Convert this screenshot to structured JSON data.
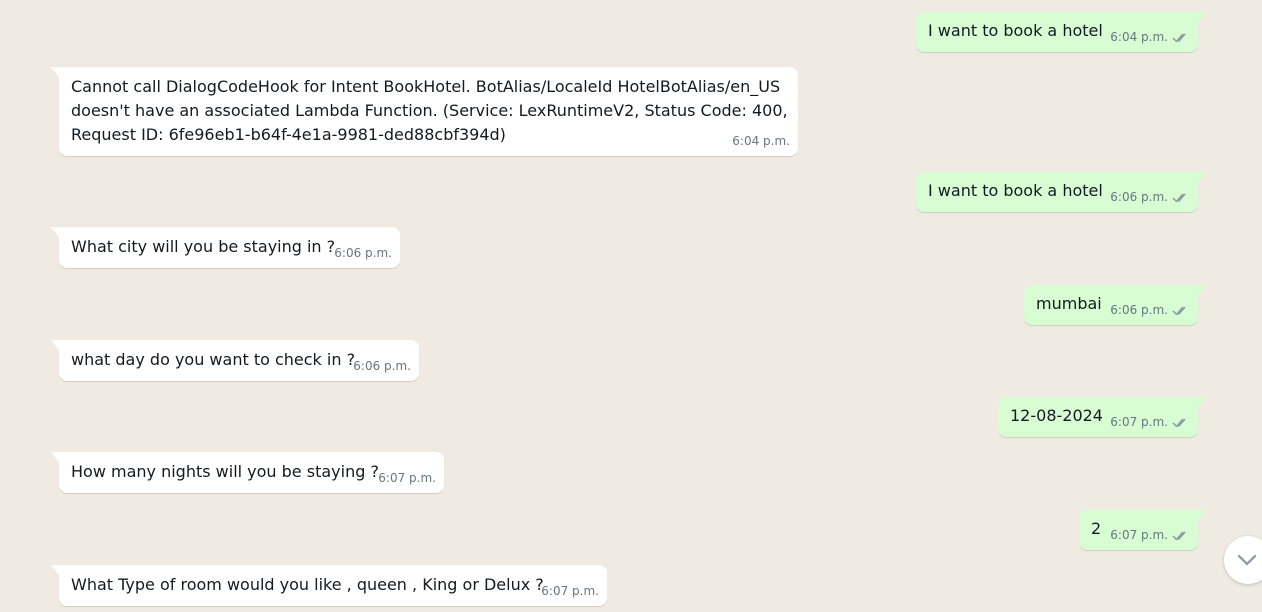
{
  "messages": [
    {
      "dir": "out",
      "text": "I want to book a hotel",
      "time": "6:04 p.m.",
      "status": "read"
    },
    {
      "dir": "in",
      "text": "Cannot call DialogCodeHook for Intent BookHotel. BotAlias/LocaleId HotelBotAlias/en_US\ndoesn't have an associated Lambda Function. (Service: LexRuntimeV2, Status Code: 400,\nRequest ID: 6fe96eb1-b64f-4e1a-9981-ded88cbf394d)",
      "time": "6:04 p.m."
    },
    {
      "dir": "out",
      "text": "I want to book a hotel",
      "time": "6:06 p.m.",
      "status": "read"
    },
    {
      "dir": "in",
      "text": "What city will you be staying in ?",
      "time": "6:06 p.m."
    },
    {
      "dir": "out",
      "text": "mumbai",
      "time": "6:06 p.m.",
      "status": "read"
    },
    {
      "dir": "in",
      "text": "what day do you want to check in ?",
      "time": "6:06 p.m."
    },
    {
      "dir": "out",
      "text": "12-08-2024",
      "time": "6:07 p.m.",
      "status": "read"
    },
    {
      "dir": "in",
      "text": "How many nights will you be staying ?",
      "time": "6:07 p.m."
    },
    {
      "dir": "out",
      "text": "2",
      "time": "6:07 p.m.",
      "status": "read"
    },
    {
      "dir": "in",
      "text": "What Type of room would you like , queen , King or Delux ?",
      "time": "6:07 p.m."
    }
  ],
  "scroll_down_button": {
    "icon": "chevron-down-icon"
  },
  "colors": {
    "outgoing_bubble": "#d9fdd3",
    "incoming_bubble": "#ffffff",
    "background": "#efeae2",
    "read_ticks": "#8696a0",
    "meta_text": "#667781"
  }
}
